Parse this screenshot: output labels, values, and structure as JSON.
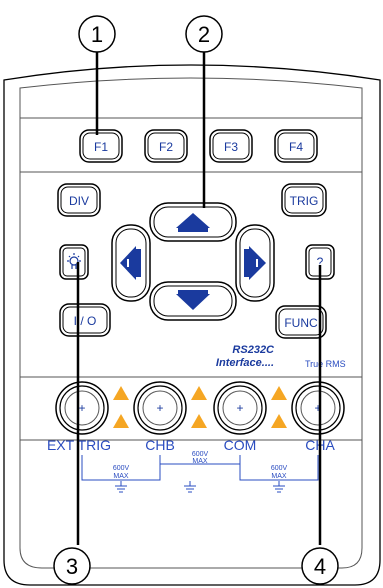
{
  "callouts": [
    "1",
    "2",
    "3",
    "4"
  ],
  "function_keys": [
    "F1",
    "F2",
    "F3",
    "F4"
  ],
  "buttons": {
    "div": "DIV",
    "trig": "TRIG",
    "help": "?",
    "power": "I / O",
    "func": "FUNC",
    "light_icon": "lightbulb-icon"
  },
  "interface_text": {
    "line1": "RS232C",
    "line2": "Interface....",
    "true_rms": "True RMS"
  },
  "jacks": {
    "symbol": "+",
    "labels": [
      "EXT TRIG",
      "CHB",
      "COM",
      "CHA"
    ]
  },
  "rating": {
    "line1": "600V",
    "line2": "MAX"
  },
  "colors": {
    "blue": "#1a3a9e",
    "warning": "#f5a623",
    "body_outline": "#000000"
  }
}
